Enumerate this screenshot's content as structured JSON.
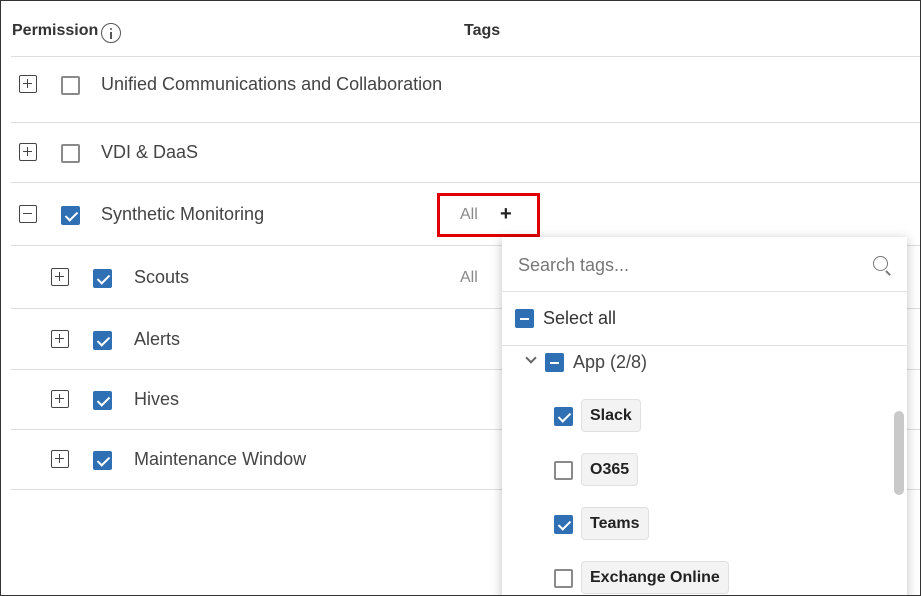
{
  "header": {
    "permission_label": "Permission",
    "tags_label": "Tags"
  },
  "rows": [
    {
      "label": "Unified Communications and Collaboration",
      "expanded": false,
      "checked": false
    },
    {
      "label": "VDI & DaaS",
      "expanded": false,
      "checked": false
    },
    {
      "label": "Synthetic Monitoring",
      "expanded": true,
      "checked": true,
      "tags_value": "All",
      "add_tag_label": "+"
    },
    {
      "label": "Scouts",
      "expanded": false,
      "checked": true,
      "tags_value": "All"
    },
    {
      "label": "Alerts",
      "expanded": false,
      "checked": true
    },
    {
      "label": "Hives",
      "expanded": false,
      "checked": true
    },
    {
      "label": "Maintenance Window",
      "expanded": false,
      "checked": true
    }
  ],
  "tag_dropdown": {
    "search_placeholder": "Search tags...",
    "select_all_label": "Select all",
    "select_all_state": "partial",
    "group": {
      "label": "App (2/8)",
      "state": "partial",
      "expanded": true,
      "tags": [
        {
          "label": "Slack",
          "checked": true
        },
        {
          "label": "O365",
          "checked": false
        },
        {
          "label": "Teams",
          "checked": true
        },
        {
          "label": "Exchange Online",
          "checked": false
        }
      ]
    }
  },
  "colors": {
    "checkbox_checked": "#2f6fb3",
    "highlight_border": "#e00000"
  },
  "icons": [
    "info-icon",
    "expand-icon",
    "collapse-icon",
    "search-icon",
    "chevron-down-icon"
  ]
}
